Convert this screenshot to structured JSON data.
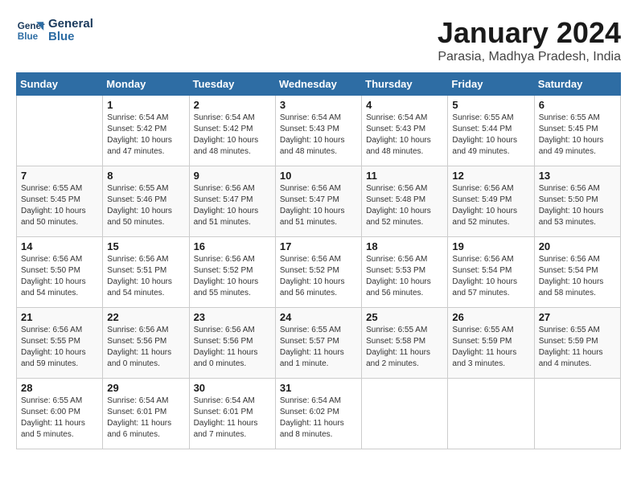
{
  "logo": {
    "line1": "General",
    "line2": "Blue"
  },
  "title": "January 2024",
  "location": "Parasia, Madhya Pradesh, India",
  "days_of_week": [
    "Sunday",
    "Monday",
    "Tuesday",
    "Wednesday",
    "Thursday",
    "Friday",
    "Saturday"
  ],
  "weeks": [
    [
      {
        "day": "",
        "info": ""
      },
      {
        "day": "1",
        "info": "Sunrise: 6:54 AM\nSunset: 5:42 PM\nDaylight: 10 hours\nand 47 minutes."
      },
      {
        "day": "2",
        "info": "Sunrise: 6:54 AM\nSunset: 5:42 PM\nDaylight: 10 hours\nand 48 minutes."
      },
      {
        "day": "3",
        "info": "Sunrise: 6:54 AM\nSunset: 5:43 PM\nDaylight: 10 hours\nand 48 minutes."
      },
      {
        "day": "4",
        "info": "Sunrise: 6:54 AM\nSunset: 5:43 PM\nDaylight: 10 hours\nand 48 minutes."
      },
      {
        "day": "5",
        "info": "Sunrise: 6:55 AM\nSunset: 5:44 PM\nDaylight: 10 hours\nand 49 minutes."
      },
      {
        "day": "6",
        "info": "Sunrise: 6:55 AM\nSunset: 5:45 PM\nDaylight: 10 hours\nand 49 minutes."
      }
    ],
    [
      {
        "day": "7",
        "info": "Sunrise: 6:55 AM\nSunset: 5:45 PM\nDaylight: 10 hours\nand 50 minutes."
      },
      {
        "day": "8",
        "info": "Sunrise: 6:55 AM\nSunset: 5:46 PM\nDaylight: 10 hours\nand 50 minutes."
      },
      {
        "day": "9",
        "info": "Sunrise: 6:56 AM\nSunset: 5:47 PM\nDaylight: 10 hours\nand 51 minutes."
      },
      {
        "day": "10",
        "info": "Sunrise: 6:56 AM\nSunset: 5:47 PM\nDaylight: 10 hours\nand 51 minutes."
      },
      {
        "day": "11",
        "info": "Sunrise: 6:56 AM\nSunset: 5:48 PM\nDaylight: 10 hours\nand 52 minutes."
      },
      {
        "day": "12",
        "info": "Sunrise: 6:56 AM\nSunset: 5:49 PM\nDaylight: 10 hours\nand 52 minutes."
      },
      {
        "day": "13",
        "info": "Sunrise: 6:56 AM\nSunset: 5:50 PM\nDaylight: 10 hours\nand 53 minutes."
      }
    ],
    [
      {
        "day": "14",
        "info": "Sunrise: 6:56 AM\nSunset: 5:50 PM\nDaylight: 10 hours\nand 54 minutes."
      },
      {
        "day": "15",
        "info": "Sunrise: 6:56 AM\nSunset: 5:51 PM\nDaylight: 10 hours\nand 54 minutes."
      },
      {
        "day": "16",
        "info": "Sunrise: 6:56 AM\nSunset: 5:52 PM\nDaylight: 10 hours\nand 55 minutes."
      },
      {
        "day": "17",
        "info": "Sunrise: 6:56 AM\nSunset: 5:52 PM\nDaylight: 10 hours\nand 56 minutes."
      },
      {
        "day": "18",
        "info": "Sunrise: 6:56 AM\nSunset: 5:53 PM\nDaylight: 10 hours\nand 56 minutes."
      },
      {
        "day": "19",
        "info": "Sunrise: 6:56 AM\nSunset: 5:54 PM\nDaylight: 10 hours\nand 57 minutes."
      },
      {
        "day": "20",
        "info": "Sunrise: 6:56 AM\nSunset: 5:54 PM\nDaylight: 10 hours\nand 58 minutes."
      }
    ],
    [
      {
        "day": "21",
        "info": "Sunrise: 6:56 AM\nSunset: 5:55 PM\nDaylight: 10 hours\nand 59 minutes."
      },
      {
        "day": "22",
        "info": "Sunrise: 6:56 AM\nSunset: 5:56 PM\nDaylight: 11 hours\nand 0 minutes."
      },
      {
        "day": "23",
        "info": "Sunrise: 6:56 AM\nSunset: 5:56 PM\nDaylight: 11 hours\nand 0 minutes."
      },
      {
        "day": "24",
        "info": "Sunrise: 6:55 AM\nSunset: 5:57 PM\nDaylight: 11 hours\nand 1 minute."
      },
      {
        "day": "25",
        "info": "Sunrise: 6:55 AM\nSunset: 5:58 PM\nDaylight: 11 hours\nand 2 minutes."
      },
      {
        "day": "26",
        "info": "Sunrise: 6:55 AM\nSunset: 5:59 PM\nDaylight: 11 hours\nand 3 minutes."
      },
      {
        "day": "27",
        "info": "Sunrise: 6:55 AM\nSunset: 5:59 PM\nDaylight: 11 hours\nand 4 minutes."
      }
    ],
    [
      {
        "day": "28",
        "info": "Sunrise: 6:55 AM\nSunset: 6:00 PM\nDaylight: 11 hours\nand 5 minutes."
      },
      {
        "day": "29",
        "info": "Sunrise: 6:54 AM\nSunset: 6:01 PM\nDaylight: 11 hours\nand 6 minutes."
      },
      {
        "day": "30",
        "info": "Sunrise: 6:54 AM\nSunset: 6:01 PM\nDaylight: 11 hours\nand 7 minutes."
      },
      {
        "day": "31",
        "info": "Sunrise: 6:54 AM\nSunset: 6:02 PM\nDaylight: 11 hours\nand 8 minutes."
      },
      {
        "day": "",
        "info": ""
      },
      {
        "day": "",
        "info": ""
      },
      {
        "day": "",
        "info": ""
      }
    ]
  ]
}
